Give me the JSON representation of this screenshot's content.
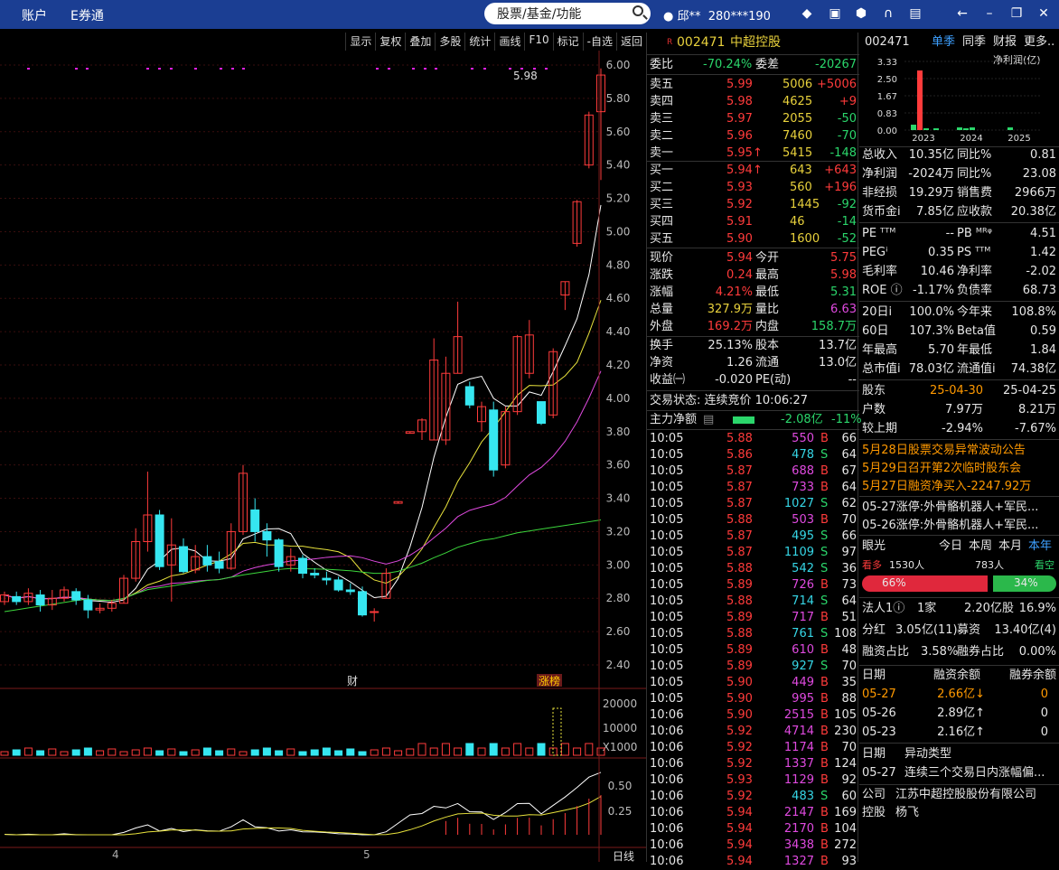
{
  "topbar": {
    "account": "账户",
    "equan": "E券通",
    "search": "股票/基金/功能",
    "user": "邱**",
    "phone": "280***190"
  },
  "toolbar": [
    "显示",
    "复权",
    "叠加",
    "多股",
    "统计",
    "画线",
    "F10",
    "标记",
    "-自选",
    "返回"
  ],
  "yticks": [
    "6.00",
    "5.80",
    "5.60",
    "5.40",
    "5.20",
    "5.00",
    "4.80",
    "4.60",
    "4.40",
    "4.20",
    "4.00",
    "3.80",
    "3.60",
    "3.40",
    "3.20",
    "3.00",
    "2.80",
    "2.60",
    "2.40"
  ],
  "vticks": [
    "20000",
    "10000",
    "X1000"
  ],
  "mticks": [
    "0.50",
    "0.25"
  ],
  "chart_labels": {
    "high": "5.98",
    "cai": "财",
    "zhangbang": "涨榜",
    "month4": "4",
    "month5": "5",
    "period": "日线"
  },
  "chart_data": {
    "type": "candlestick",
    "ylim": [
      2.3,
      6.05
    ],
    "candles": [
      [
        2.78,
        2.82,
        2.84,
        2.76
      ],
      [
        2.81,
        2.78,
        2.84,
        2.76
      ],
      [
        2.78,
        2.83,
        2.86,
        2.76
      ],
      [
        2.82,
        2.76,
        2.85,
        2.72
      ],
      [
        2.76,
        2.8,
        2.85,
        2.73
      ],
      [
        2.8,
        2.85,
        2.87,
        2.78
      ],
      [
        2.84,
        2.79,
        2.86,
        2.76
      ],
      [
        2.79,
        2.73,
        2.82,
        2.68
      ],
      [
        2.73,
        2.74,
        2.77,
        2.71
      ],
      [
        2.74,
        2.77,
        2.79,
        2.72
      ],
      [
        2.77,
        2.92,
        2.94,
        2.77
      ],
      [
        2.92,
        3.14,
        3.22,
        2.9
      ],
      [
        3.14,
        3.3,
        3.56,
        3.08
      ],
      [
        3.3,
        2.99,
        3.33,
        2.97
      ],
      [
        3.0,
        3.12,
        3.28,
        2.78
      ],
      [
        3.11,
        2.96,
        3.16,
        2.95
      ],
      [
        2.97,
        3.05,
        3.12,
        2.95
      ],
      [
        3.05,
        3.0,
        3.12,
        2.96
      ],
      [
        3.02,
        2.98,
        3.08,
        2.95
      ],
      [
        2.98,
        3.2,
        3.25,
        2.97
      ],
      [
        3.2,
        3.55,
        3.6,
        3.18
      ],
      [
        3.33,
        3.2,
        3.4,
        3.14
      ],
      [
        3.2,
        3.15,
        3.25,
        3.05
      ],
      [
        3.15,
        2.99,
        3.16,
        2.96
      ],
      [
        3.0,
        3.05,
        3.1,
        2.96
      ],
      [
        3.04,
        2.95,
        3.06,
        2.92
      ],
      [
        2.95,
        2.94,
        2.98,
        2.92
      ],
      [
        2.92,
        2.91,
        2.96,
        2.88
      ],
      [
        2.91,
        2.85,
        2.93,
        2.84
      ],
      [
        2.85,
        2.84,
        2.89,
        2.82
      ],
      [
        2.84,
        2.7,
        2.87,
        2.69
      ],
      [
        2.72,
        2.72,
        2.74,
        2.66
      ],
      [
        2.8,
        2.95,
        2.98,
        2.8
      ],
      [
        3.37,
        3.38,
        3.38,
        3.37
      ],
      [
        3.79,
        3.8,
        3.8,
        3.79
      ],
      [
        3.8,
        3.87,
        3.88,
        3.75
      ],
      [
        3.75,
        4.23,
        4.36,
        3.75
      ],
      [
        3.75,
        4.15,
        4.25,
        3.72
      ],
      [
        4.15,
        4.37,
        4.58,
        4.15
      ],
      [
        4.07,
        3.96,
        4.1,
        3.94
      ],
      [
        3.86,
        3.95,
        3.98,
        3.8
      ],
      [
        3.93,
        3.57,
        3.98,
        3.53
      ],
      [
        3.6,
        3.92,
        3.95,
        3.58
      ],
      [
        3.92,
        4.37,
        4.38,
        3.9
      ],
      [
        4.15,
        4.38,
        4.47,
        4.12
      ],
      [
        3.98,
        3.85,
        3.98,
        3.84
      ],
      [
        3.9,
        4.28,
        4.3,
        3.88
      ],
      [
        4.62,
        4.7,
        4.7,
        4.53
      ],
      [
        4.93,
        5.18,
        5.19,
        4.91
      ],
      [
        5.4,
        5.7,
        5.72,
        5.38
      ],
      [
        5.72,
        5.94,
        5.98,
        5.31
      ]
    ]
  },
  "quote": {
    "code": "002471",
    "name": "中超控股",
    "weibi_label": "委比",
    "weibi": "-70.24%",
    "weicha_label": "委差",
    "weicha": "-20267",
    "sells": [
      [
        "卖五",
        "5.99",
        "5006",
        "+5006"
      ],
      [
        "卖四",
        "5.98",
        "4625",
        "+9"
      ],
      [
        "卖三",
        "5.97",
        "2055",
        "-50"
      ],
      [
        "卖二",
        "5.96",
        "7460",
        "-70"
      ],
      [
        "卖一",
        "5.95↑",
        "5415",
        "-148"
      ]
    ],
    "buys": [
      [
        "买一",
        "5.94↑",
        "643",
        "+643"
      ],
      [
        "买二",
        "5.93",
        "560",
        "+196"
      ],
      [
        "买三",
        "5.92",
        "1445",
        "-92"
      ],
      [
        "买四",
        "5.91",
        "46",
        "-14"
      ],
      [
        "买五",
        "5.90",
        "1600",
        "-52"
      ]
    ],
    "stats": [
      [
        "现价",
        "5.94",
        "今开",
        "5.75"
      ],
      [
        "涨跌",
        "0.24",
        "最高",
        "5.98"
      ],
      [
        "涨幅",
        "4.21%",
        "最低",
        "5.31"
      ],
      [
        "总量",
        "327.9万",
        "量比",
        "6.63"
      ],
      [
        "外盘",
        "169.2万",
        "内盘",
        "158.7万"
      ]
    ],
    "stats2": [
      [
        "换手",
        "25.13%",
        "股本",
        "13.7亿"
      ],
      [
        "净资",
        "1.26",
        "流通",
        "13.0亿"
      ],
      [
        "收益㈠",
        "-0.020",
        "PE(动)",
        "--"
      ]
    ],
    "state": "交易状态: 连续竞价 10:06:27",
    "flow_label": "主力净额",
    "flow": "-2.08亿",
    "flow_pct": "-11%"
  },
  "ticks": [
    [
      "10:05",
      "5.88",
      "550",
      "B",
      "66"
    ],
    [
      "10:05",
      "5.86",
      "478",
      "S",
      "64"
    ],
    [
      "10:05",
      "5.87",
      "688",
      "B",
      "67"
    ],
    [
      "10:05",
      "5.87",
      "733",
      "B",
      "64"
    ],
    [
      "10:05",
      "5.87",
      "1027",
      "S",
      "62"
    ],
    [
      "10:05",
      "5.88",
      "503",
      "B",
      "70"
    ],
    [
      "10:05",
      "5.87",
      "495",
      "S",
      "66"
    ],
    [
      "10:05",
      "5.87",
      "1109",
      "S",
      "97"
    ],
    [
      "10:05",
      "5.88",
      "542",
      "S",
      "36"
    ],
    [
      "10:05",
      "5.89",
      "726",
      "B",
      "73"
    ],
    [
      "10:05",
      "5.88",
      "714",
      "S",
      "64"
    ],
    [
      "10:05",
      "5.89",
      "717",
      "B",
      "51"
    ],
    [
      "10:05",
      "5.88",
      "761",
      "S",
      "108"
    ],
    [
      "10:05",
      "5.89",
      "610",
      "B",
      "48"
    ],
    [
      "10:05",
      "5.89",
      "927",
      "S",
      "70"
    ],
    [
      "10:05",
      "5.90",
      "449",
      "B",
      "35"
    ],
    [
      "10:05",
      "5.90",
      "995",
      "B",
      "88"
    ],
    [
      "10:06",
      "5.90",
      "2515",
      "B",
      "105"
    ],
    [
      "10:06",
      "5.92",
      "4714",
      "B",
      "230"
    ],
    [
      "10:06",
      "5.92",
      "1174",
      "B",
      "70"
    ],
    [
      "10:06",
      "5.92",
      "1337",
      "B",
      "124"
    ],
    [
      "10:06",
      "5.93",
      "1129",
      "B",
      "92"
    ],
    [
      "10:06",
      "5.92",
      "483",
      "S",
      "60"
    ],
    [
      "10:06",
      "5.94",
      "2147",
      "B",
      "169"
    ],
    [
      "10:06",
      "5.94",
      "2170",
      "B",
      "104"
    ],
    [
      "10:06",
      "5.94",
      "3438",
      "B",
      "272"
    ],
    [
      "10:06",
      "5.94",
      "1327",
      "B",
      "93"
    ]
  ],
  "fin": {
    "code": "002471",
    "tabs": [
      "单季",
      "同季",
      "财报",
      "更多.."
    ],
    "profit_label": "净利润(亿)",
    "yt": [
      "3.33",
      "2.50",
      "1.67",
      "0.83",
      "0.00"
    ],
    "years": [
      "2023",
      "2024",
      "2025"
    ],
    "rows": [
      [
        "总收入",
        "10.35亿",
        "同比%",
        "0.81"
      ],
      [
        "净利润",
        "-2024万",
        "同比%",
        "23.08"
      ],
      [
        "非经损",
        "19.29万",
        "销售费",
        "2966万"
      ],
      [
        "货币金i",
        "7.85亿",
        "应收款",
        "20.38亿"
      ]
    ],
    "val": [
      [
        "PE ᵀᵀᴹ",
        "--",
        "PB ᴹᴿᵠ",
        "4.51"
      ],
      [
        "PEGⁱ",
        "0.35",
        "PS ᵀᵀᴹ",
        "1.42"
      ],
      [
        "毛利率",
        "10.46",
        "净利率",
        "-2.02"
      ],
      [
        "ROE ⓘ",
        "-1.17%",
        "负债率",
        "68.73"
      ]
    ],
    "perf": [
      [
        "20日i",
        "100.0%",
        "今年来",
        "108.8%"
      ],
      [
        "60日",
        "107.3%",
        "Beta值",
        "0.59"
      ],
      [
        "年最高",
        "5.70",
        "年最低",
        "1.84"
      ],
      [
        "总市值i",
        "78.03亿",
        "流通值i",
        "74.38亿"
      ]
    ],
    "holders": [
      [
        "股东",
        "25-04-30",
        "25-04-25"
      ],
      [
        "户数",
        "7.97万",
        "8.21万"
      ],
      [
        "较上期",
        "-2.94%",
        "-7.67%"
      ]
    ],
    "news": [
      "5月28日股票交易异常波动公告",
      "5月29日召开第2次临时股东会",
      "5月27日融资净买入-2247.92万"
    ],
    "news2": [
      "05-27涨停:外骨骼机器人+军民...",
      "05-26涨停:外骨骼机器人+军民..."
    ],
    "eye": {
      "label": "眼光",
      "tabs": [
        "今日",
        "本周",
        "本月",
        "本年"
      ],
      "bull": "看多",
      "bull_n": "1530人",
      "bear_n": "783人",
      "bear": "看空",
      "bull_pct": "66%",
      "bear_pct": "34%"
    },
    "misc": [
      [
        "法人1ⓘ",
        "1家",
        "2.20亿股",
        "16.9%"
      ],
      [
        "分红",
        "3.05亿(11)",
        "募资",
        "13.40亿(4)"
      ],
      [
        "融资占比",
        "3.58%",
        "融券占比",
        "0.00%"
      ]
    ],
    "margin_head": [
      "日期",
      "融资余额",
      "融券余额"
    ],
    "margin": [
      [
        "05-27",
        "2.66亿↓",
        "0"
      ],
      [
        "05-26",
        "2.89亿↑",
        "0"
      ],
      [
        "05-23",
        "2.16亿↑",
        "0"
      ]
    ],
    "abn_head": [
      "日期",
      "异动类型"
    ],
    "abn": [
      "05-27",
      "连续三个交易日内涨幅偏..."
    ],
    "company": [
      "公司",
      "江苏中超控股股份有限公司"
    ],
    "ctrl": [
      "控股",
      "杨飞"
    ]
  }
}
